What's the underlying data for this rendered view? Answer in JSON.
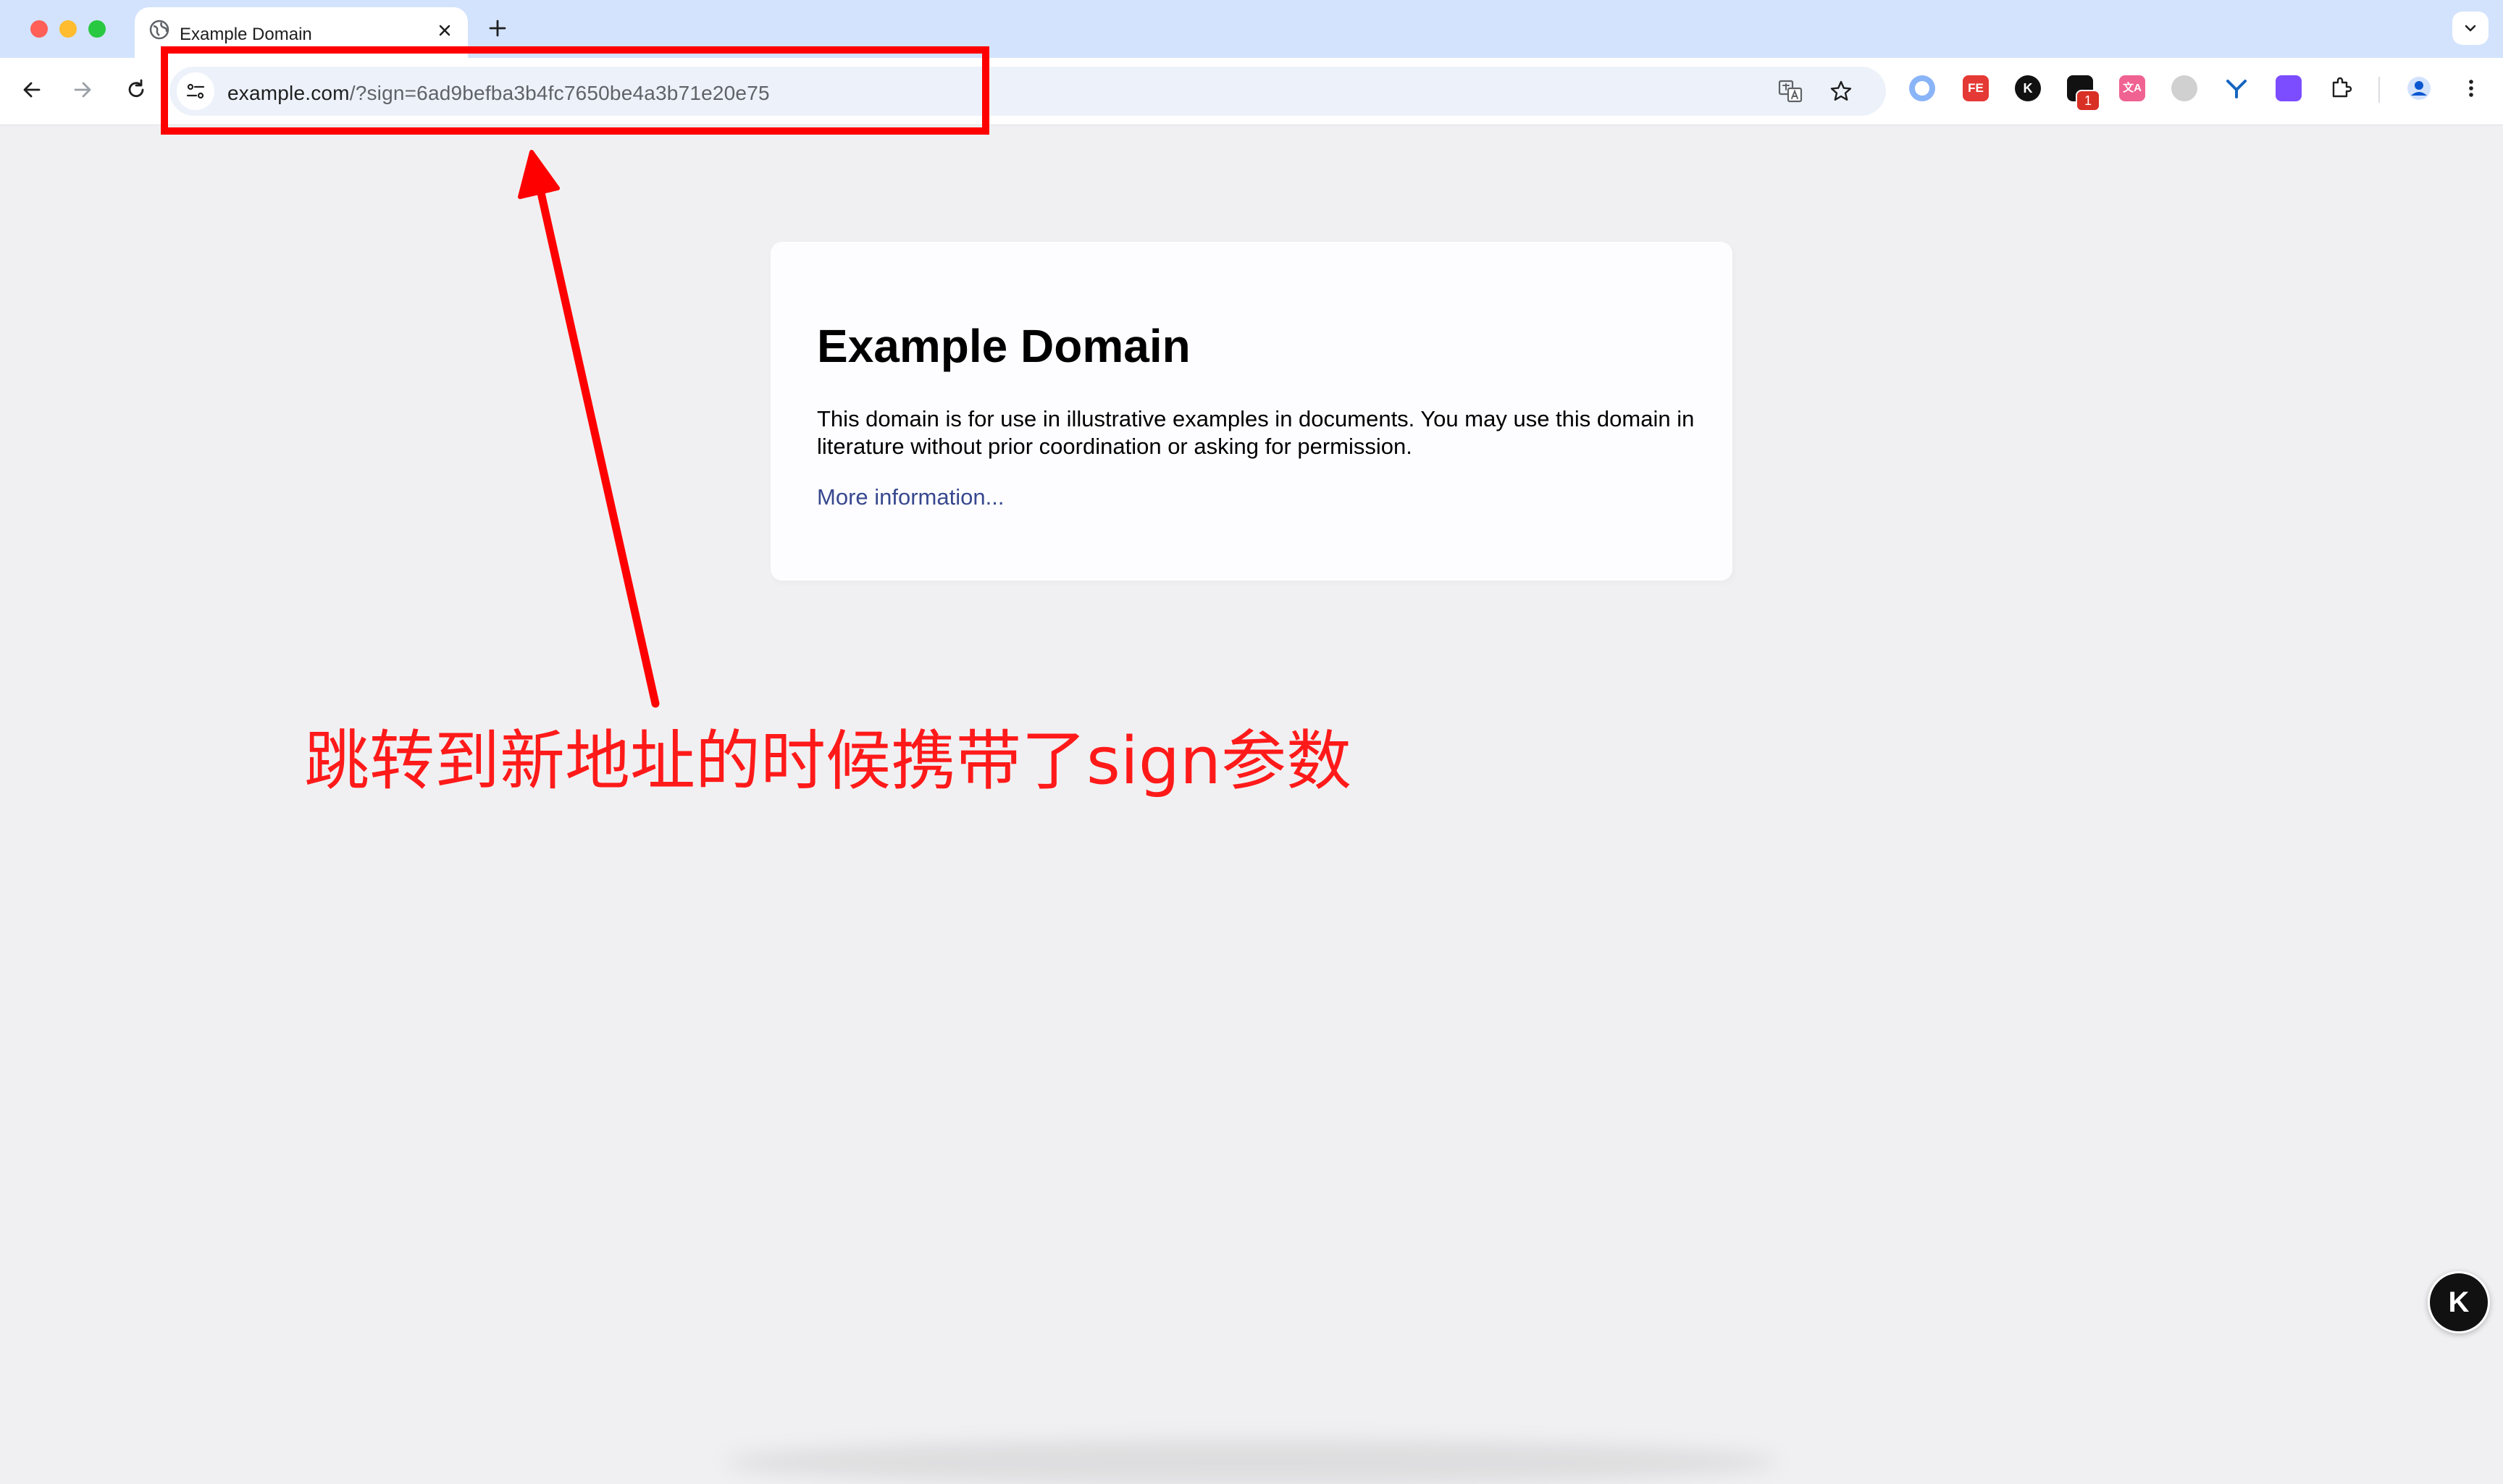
{
  "browser": {
    "tab_title": "Example Domain",
    "url_host": "example.com",
    "url_rest": "/?sign=6ad9befba3b4fc7650be4a3b71e20e75"
  },
  "extensions": {
    "feed_label": "FE",
    "k_label": "K",
    "badge_count": "1",
    "translate_label": "文A"
  },
  "page": {
    "heading": "Example Domain",
    "body": "This domain is for use in illustrative examples in documents. You may use this domain in literature without prior coordination or asking for permission.",
    "link": "More information..."
  },
  "annotation": {
    "text": "跳转到新地址的时候携带了sign参数",
    "color": "#ff0000"
  },
  "floating_button": {
    "label": "K"
  },
  "colors": {
    "tabstrip": "#d3e3fd",
    "omnibox": "#edf2fa",
    "link": "#38488f",
    "page_bg": "#f0f0f2"
  }
}
